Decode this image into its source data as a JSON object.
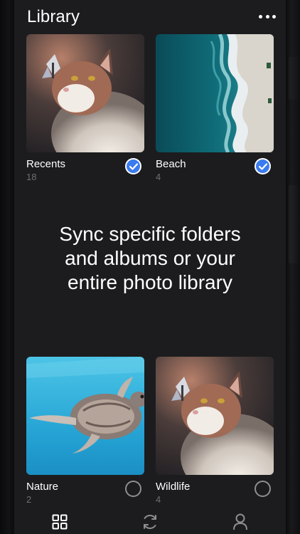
{
  "header": {
    "title": "Library",
    "more_icon": "ellipsis-icon"
  },
  "albums": [
    {
      "label": "Recents",
      "count": "18",
      "selected": true,
      "image": "cat-with-butterfly"
    },
    {
      "label": "Beach",
      "count": "4",
      "selected": true,
      "image": "aerial-beach-waves"
    },
    {
      "label": "Nature",
      "count": "2",
      "selected": false,
      "image": "sea-turtle-underwater"
    },
    {
      "label": "Wildlife",
      "count": "4",
      "selected": false,
      "image": "cat-with-butterfly"
    }
  ],
  "headline": {
    "line1": "Sync specific folders",
    "line2": "and albums or your",
    "line3": "entire photo library"
  },
  "tabbar": {
    "items": [
      {
        "icon": "grid-icon",
        "active": true
      },
      {
        "icon": "sync-icon",
        "active": false
      },
      {
        "icon": "profile-icon",
        "active": false
      }
    ]
  },
  "colors": {
    "background": "#1c1c1e",
    "accent": "#3a7bf0",
    "secondary_text": "#6e6e73",
    "tab_icon": "#8e8e93"
  }
}
